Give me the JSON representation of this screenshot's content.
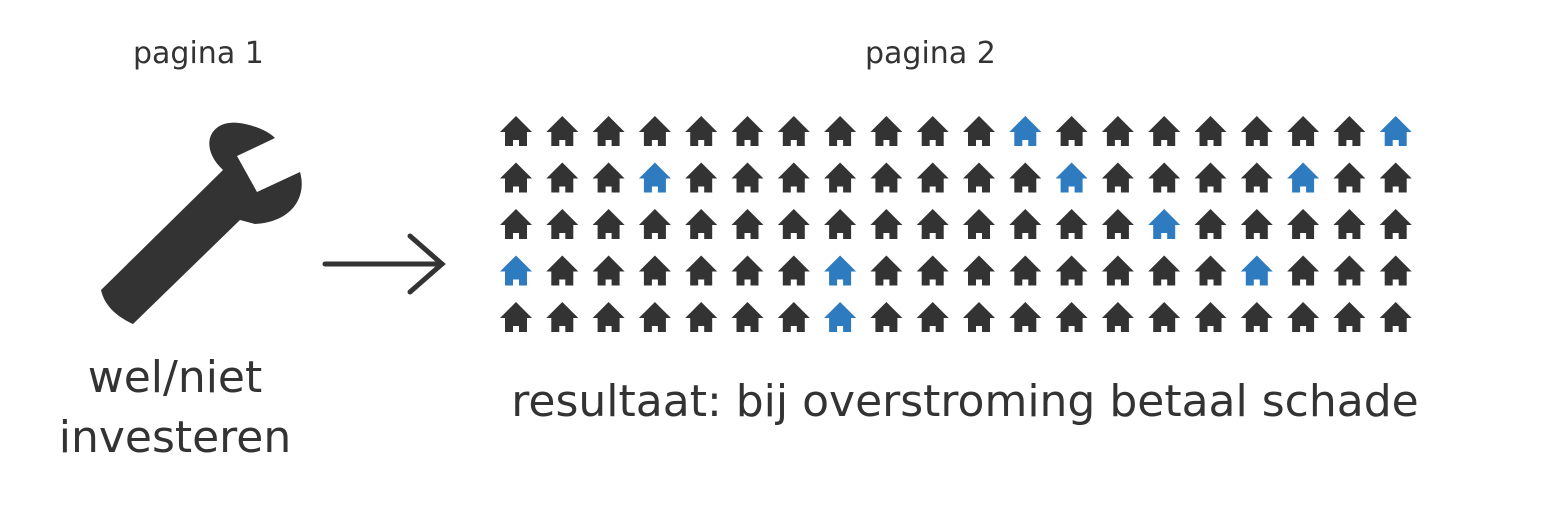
{
  "page1": {
    "label": "pagina 1",
    "icon": "wrench-icon",
    "caption_line1": "wel/niet",
    "caption_line2": "investeren"
  },
  "page2": {
    "label": "pagina 2",
    "icon": "house-icon",
    "caption": "resultaat: bij overstroming betaal schade"
  },
  "connector_icon": "arrow-right-icon",
  "colors": {
    "dark": "#333333",
    "accent": "#2e7bbf"
  },
  "house_grid": {
    "rows": 5,
    "cols": 20,
    "highlighted": [
      [
        0,
        11
      ],
      [
        0,
        19
      ],
      [
        1,
        3
      ],
      [
        1,
        12
      ],
      [
        1,
        17
      ],
      [
        2,
        14
      ],
      [
        3,
        0
      ],
      [
        3,
        7
      ],
      [
        3,
        16
      ],
      [
        4,
        7
      ]
    ]
  }
}
